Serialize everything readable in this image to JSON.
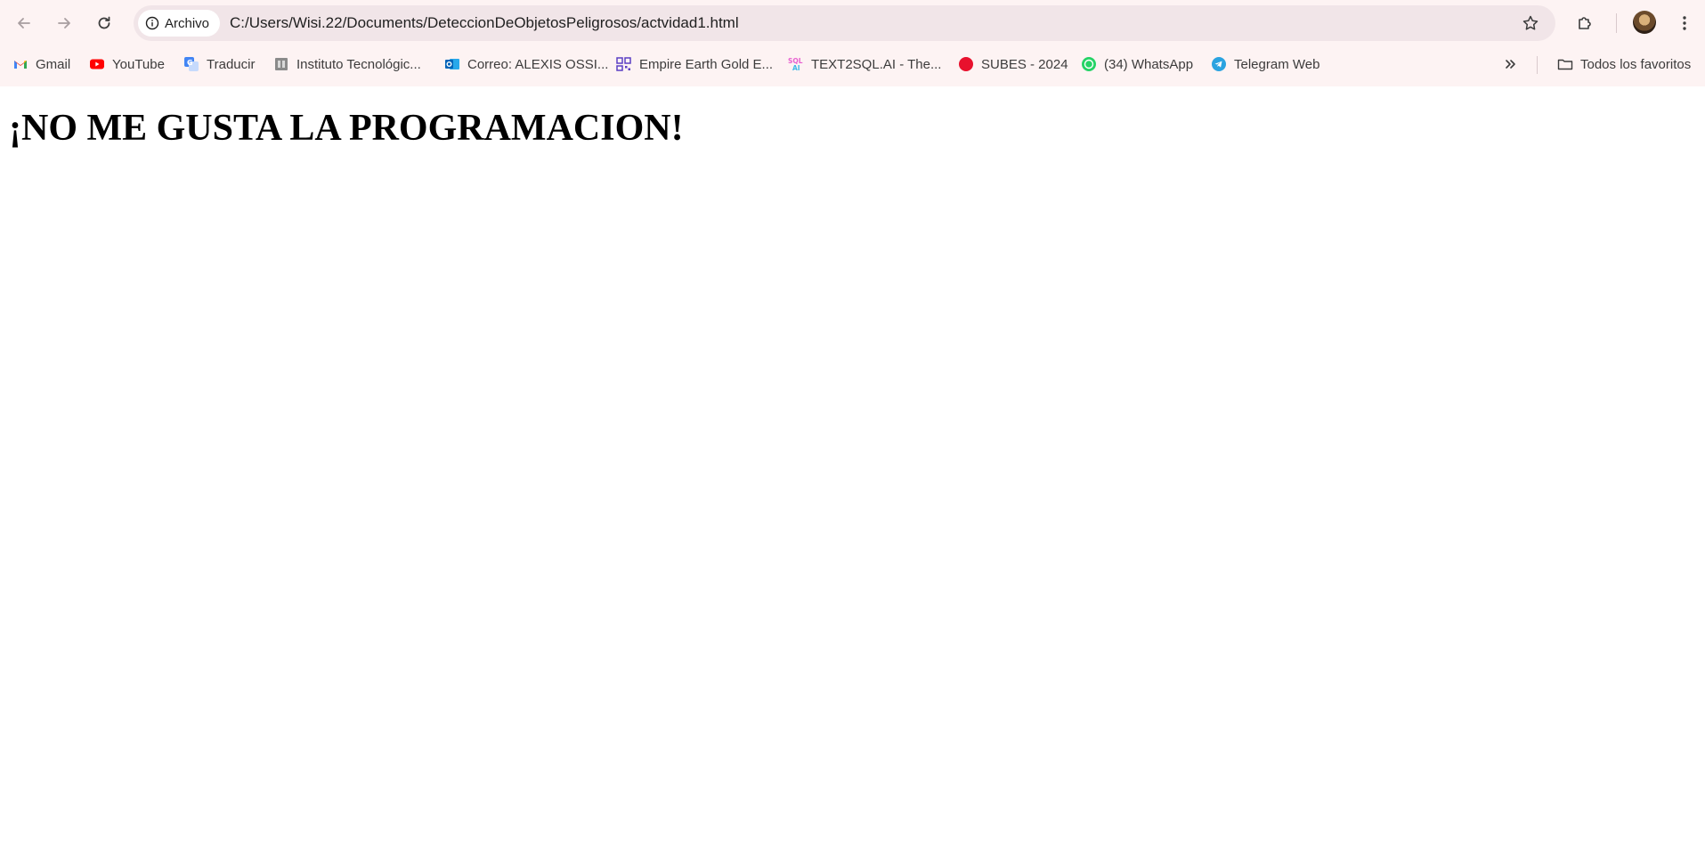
{
  "toolbar": {
    "back_icon": "arrow-left-icon",
    "forward_icon": "arrow-right-icon",
    "reload_icon": "reload-icon"
  },
  "omnibox": {
    "site_chip_label": "Archivo",
    "url": "C:/Users/Wisi.22/Documents/DeteccionDeObjetosPeligrosos/actvidad1.html"
  },
  "bookmarks": {
    "items": [
      {
        "label": "Gmail",
        "icon": "gmail-icon"
      },
      {
        "label": "YouTube",
        "icon": "youtube-icon"
      },
      {
        "label": "Traducir",
        "icon": "translate-icon"
      },
      {
        "label": "Instituto Tecnológic...",
        "icon": "institute-icon"
      },
      {
        "label": "Correo: ALEXIS OSSI...",
        "icon": "outlook-icon"
      },
      {
        "label": "Empire Earth Gold E...",
        "icon": "qr-icon"
      },
      {
        "label": "TEXT2SQL.AI - The...",
        "icon": "sql-ai-icon"
      },
      {
        "label": "SUBES - 2024",
        "icon": "red-dot-icon"
      },
      {
        "label": "(34) WhatsApp",
        "icon": "whatsapp-icon"
      },
      {
        "label": "Telegram Web",
        "icon": "telegram-icon"
      }
    ],
    "all_bookmarks_label": "Todos los favoritos"
  },
  "page": {
    "heading": "¡NO ME GUSTA LA PROGRAMACION!"
  },
  "colors": {
    "chrome_bg": "#fdf3f3",
    "omnibox_bg": "#f1e5e8",
    "text": "#1f1f1f"
  }
}
